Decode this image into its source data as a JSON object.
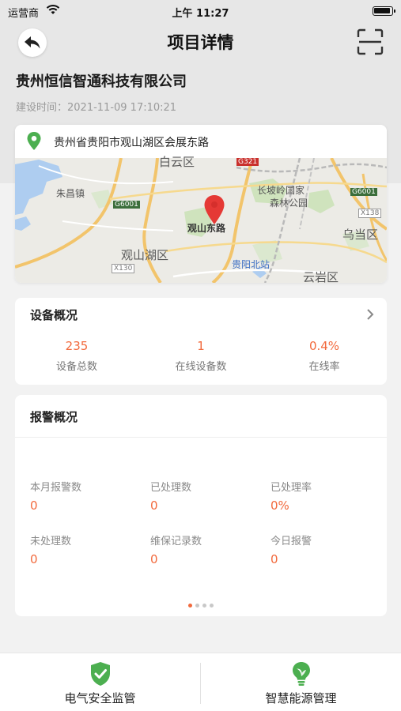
{
  "status_bar": {
    "carrier": "运营商",
    "time": "上午 11:27"
  },
  "nav": {
    "title": "项目详情"
  },
  "project": {
    "company": "贵州恒信智通科技有限公司",
    "build_time": "建设时间：2021-11-09 17:10:21"
  },
  "map": {
    "address": "贵州省贵阳市观山湖区会展东路",
    "labels": {
      "baiyun": "白云区",
      "zhuchang": "朱昌镇",
      "changpoling": "长坡岭国家",
      "senlin": "森林公园",
      "wudang": "乌当区",
      "guanshanhu": "观山湖区",
      "yunyan": "云岩区",
      "guiyang_north": "贵阳北站",
      "marker": "观山东路",
      "g6001_left": "G6001",
      "g6001_right": "G6001",
      "g321": "G321",
      "x130": "X130",
      "x138": "X138"
    }
  },
  "device_overview": {
    "title": "设备概况",
    "stats": [
      {
        "value": "235",
        "label": "设备总数"
      },
      {
        "value": "1",
        "label": "在线设备数"
      },
      {
        "value": "0.4%",
        "label": "在线率"
      }
    ]
  },
  "alarm_overview": {
    "title": "报警概况",
    "items": [
      {
        "label": "本月报警数",
        "value": "0"
      },
      {
        "label": "已处理数",
        "value": "0"
      },
      {
        "label": "已处理率",
        "value": "0%"
      },
      {
        "label": "未处理数",
        "value": "0"
      },
      {
        "label": "维保记录数",
        "value": "0"
      },
      {
        "label": "今日报警",
        "value": "0"
      }
    ]
  },
  "bottom_tabs": [
    {
      "label": "电气安全监管",
      "icon": "shield-check-icon"
    },
    {
      "label": "智慧能源管理",
      "icon": "lightbulb-leaf-icon"
    }
  ],
  "colors": {
    "accent": "#f26a3d",
    "green": "#4caf50"
  }
}
